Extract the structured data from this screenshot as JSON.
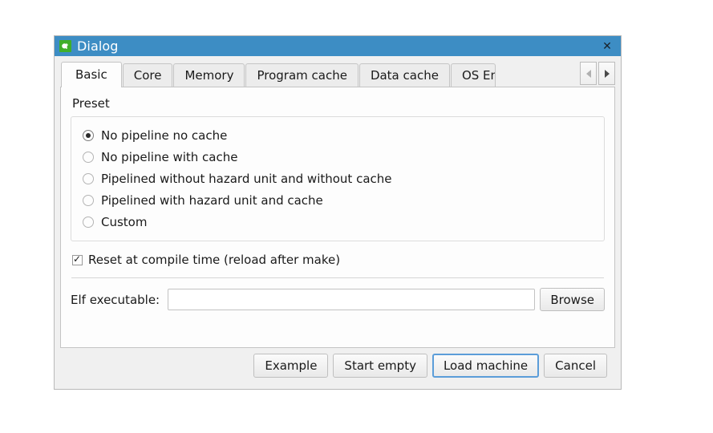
{
  "window": {
    "title": "Dialog",
    "icon": "qt-logo-icon",
    "close_label": "✕",
    "titlebar_color": "#3d8dc4",
    "icon_color": "#3fae2a"
  },
  "tabs": {
    "items": [
      {
        "label": "Basic",
        "active": true,
        "clipped": false
      },
      {
        "label": "Core",
        "active": false,
        "clipped": false
      },
      {
        "label": "Memory",
        "active": false,
        "clipped": false
      },
      {
        "label": "Program cache",
        "active": false,
        "clipped": false
      },
      {
        "label": "Data cache",
        "active": false,
        "clipped": false
      },
      {
        "label": "OS Emulation",
        "active": false,
        "clipped": true
      }
    ],
    "scroll_left_icon": "chevron-left-icon",
    "scroll_right_icon": "chevron-right-icon"
  },
  "basic": {
    "preset_label": "Preset",
    "presets": [
      {
        "label": "No pipeline no cache",
        "selected": true
      },
      {
        "label": "No pipeline with cache",
        "selected": false
      },
      {
        "label": "Pipelined without hazard unit and without cache",
        "selected": false
      },
      {
        "label": "Pipelined with hazard unit and cache",
        "selected": false
      },
      {
        "label": "Custom",
        "selected": false
      }
    ],
    "reset_checkbox": {
      "label": "Reset at compile time (reload after make)",
      "checked": true
    },
    "elf": {
      "label": "Elf executable:",
      "value": "",
      "placeholder": "",
      "browse_label": "Browse"
    }
  },
  "buttons": {
    "example": "Example",
    "start_empty": "Start empty",
    "load_machine": "Load machine",
    "cancel": "Cancel",
    "default_focus_color": "#5b9dd9"
  }
}
